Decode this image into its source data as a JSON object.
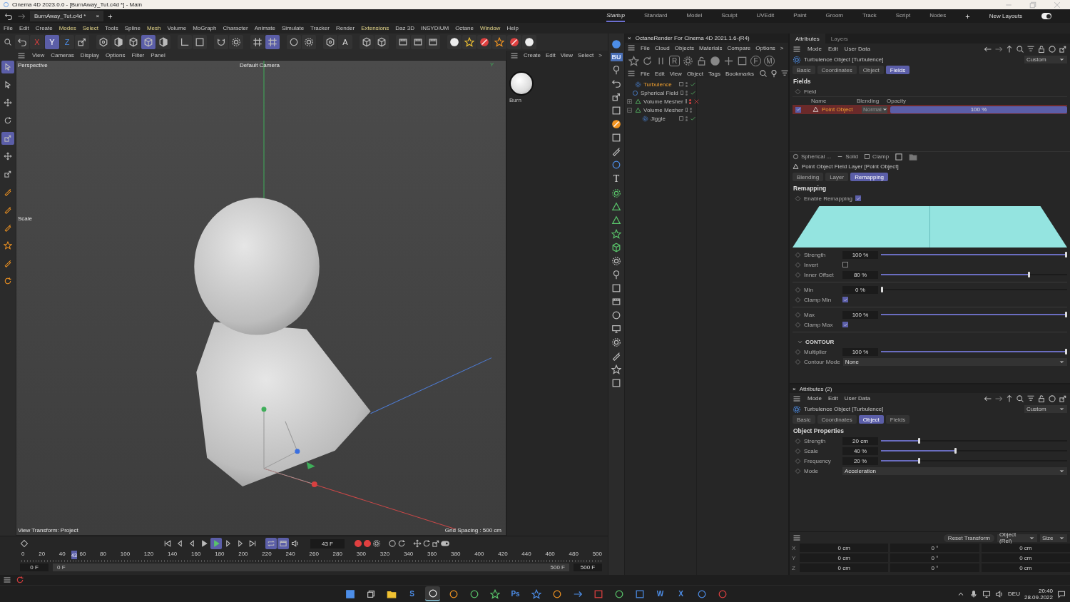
{
  "window": {
    "title": "Cinema 4D 2023.0.0 - [BurnAway_Tut.c4d *] - Main"
  },
  "document_tabs": [
    {
      "label": "BurnAway_Tut.c4d *",
      "close": "×",
      "selected": true
    }
  ],
  "new_tab": "+",
  "layouts": [
    {
      "label": "Startup",
      "selected": true
    },
    {
      "label": "Standard",
      "selected": false
    },
    {
      "label": "Model",
      "selected": false
    },
    {
      "label": "Sculpt",
      "selected": false
    },
    {
      "label": "UVEdit",
      "selected": false
    },
    {
      "label": "Paint",
      "selected": false
    },
    {
      "label": "Groom",
      "selected": false
    },
    {
      "label": "Track",
      "selected": false
    },
    {
      "label": "Script",
      "selected": false
    },
    {
      "label": "Nodes",
      "selected": false
    }
  ],
  "add_layout": "+",
  "new_layouts": {
    "label": "New Layouts",
    "on": true
  },
  "menu_bar": [
    {
      "label": "File",
      "highlighted": false
    },
    {
      "label": "Edit",
      "highlighted": false
    },
    {
      "label": "Create",
      "highlighted": false
    },
    {
      "label": "Modes",
      "highlighted": true
    },
    {
      "label": "Select",
      "highlighted": true
    },
    {
      "label": "Tools",
      "highlighted": false
    },
    {
      "label": "Spline",
      "highlighted": false
    },
    {
      "label": "Mesh",
      "highlighted": true
    },
    {
      "label": "Volume",
      "highlighted": false
    },
    {
      "label": "MoGraph",
      "highlighted": false
    },
    {
      "label": "Character",
      "highlighted": false
    },
    {
      "label": "Animate",
      "highlighted": false
    },
    {
      "label": "Simulate",
      "highlighted": false
    },
    {
      "label": "Tracker",
      "highlighted": false
    },
    {
      "label": "Render",
      "highlighted": false
    },
    {
      "label": "Extensions",
      "highlighted": true
    },
    {
      "label": "Daz 3D",
      "highlighted": false
    },
    {
      "label": "INSYDIUM",
      "highlighted": false
    },
    {
      "label": "Octane",
      "highlighted": false
    },
    {
      "label": "Window",
      "highlighted": true
    },
    {
      "label": "Help",
      "highlighted": false
    }
  ],
  "toolbar": [
    {
      "selected": false
    },
    {
      "label": "X",
      "selected": false
    },
    {
      "label": "Y",
      "selected": true
    },
    {
      "label": "Z",
      "selected": false
    },
    {
      "selected": false
    },
    {
      "selected": false
    },
    {
      "selected": false
    },
    {
      "selected": false
    },
    {
      "selected": true
    },
    {
      "selected": false
    },
    {
      "selected": false
    },
    {
      "selected": false
    },
    {
      "selected": false
    },
    {
      "selected": false
    },
    {
      "selected": false
    },
    {
      "selected": true
    },
    {
      "selected": false
    },
    {
      "selected": false
    },
    {
      "selected": false
    },
    {
      "label": "A",
      "selected": false
    },
    {
      "selected": false
    },
    {
      "selected": false
    },
    {
      "selected": false
    },
    {
      "selected": false
    },
    {
      "selected": false
    },
    {
      "selected": false
    },
    {
      "selected": false
    },
    {
      "selected": false
    },
    {
      "selected": false
    },
    {
      "selected": false
    },
    {
      "selected": false
    }
  ],
  "tool_strip": [
    {
      "selected": true
    },
    {
      "selected": false
    },
    {
      "selected": false
    },
    {
      "selected": false
    },
    {
      "selected": true
    },
    {
      "selected": false
    },
    {
      "selected": false
    },
    {
      "selected": false
    },
    {
      "selected": false
    },
    {
      "selected": false
    },
    {
      "selected": false
    },
    {
      "selected": false
    },
    {
      "selected": false
    }
  ],
  "viewport": {
    "menu": [
      "View",
      "Cameras",
      "Display",
      "Options",
      "Filter",
      "Panel"
    ],
    "camera_view": "Perspective",
    "camera": "Default Camera",
    "tool_label": "Scale",
    "axis_label": "Y",
    "view_transform": "View Transform: Project",
    "grid_spacing": "Grid Spacing : 500 cm"
  },
  "material_manager": {
    "menu": [
      "Create",
      "Edit",
      "View",
      "Select",
      ">"
    ],
    "materials": [
      {
        "name": "Burn"
      }
    ]
  },
  "side_strip": {
    "badge": "BU",
    "text_tool": "T"
  },
  "octane": {
    "close": "×",
    "title": "OctaneRender For Cinema 4D 2021.1.6-(R4)",
    "menu": [
      "File",
      "Cloud",
      "Objects",
      "Materials",
      "Compare",
      "Options",
      ">"
    ],
    "render_button": "R",
    "f_button": "F",
    "m_button": "M"
  },
  "object_manager": {
    "menu": [
      "File",
      "Edit",
      "View",
      "Object",
      "Tags",
      "Bookmarks"
    ],
    "objects": [
      {
        "name": "Turbulence",
        "kind": "deformer",
        "selected": true,
        "enabled": true
      },
      {
        "name": "Spherical Field",
        "kind": "field",
        "selected": false,
        "enabled": true
      },
      {
        "name": "Volume Mesher",
        "kind": "mesher",
        "selected": false,
        "enabled": false,
        "expanded": false
      },
      {
        "name": "Volume Mesher",
        "kind": "mesher",
        "selected": false,
        "expanded": true,
        "children": [
          {
            "name": "Jiggle",
            "kind": "deformer",
            "selected": false,
            "enabled": true
          }
        ]
      }
    ]
  },
  "attributes": {
    "tabs": [
      {
        "label": "Attributes",
        "selected": true
      },
      {
        "label": "Layers",
        "selected": false
      }
    ],
    "menu": [
      "Mode",
      "Edit",
      "User Data"
    ],
    "object_title": "Turbulence Object [Turbulence]",
    "preset": "Custom",
    "object_tabs": [
      {
        "label": "Basic",
        "selected": false
      },
      {
        "label": "Coordinates",
        "selected": false
      },
      {
        "label": "Object",
        "selected": false
      },
      {
        "label": "Fields",
        "selected": true
      }
    ],
    "section": "Fields",
    "field_label": "Field",
    "columns": [
      "Name",
      "Blending",
      "Opacity"
    ],
    "field_rows": [
      {
        "checked": true,
        "name": "Point Object",
        "selected": true,
        "blending": "Normal",
        "opacity": "100 %",
        "level": 1
      }
    ],
    "layer_toolbar": [
      "Spherical ...",
      "Solid",
      "Clamp"
    ],
    "layer_title": "Point Object Field Layer [Point Object]",
    "layer_tabs": [
      {
        "label": "Blending",
        "selected": false
      },
      {
        "label": "Layer",
        "selected": false
      },
      {
        "label": "Remapping",
        "selected": true
      }
    ],
    "remap_section": "Remapping",
    "enable_remapping": {
      "label": "Enable Remapping",
      "checked": true
    },
    "params": [
      {
        "kind": "slider",
        "label": "Strength",
        "value": "100 %",
        "level": 1
      },
      {
        "kind": "checkbox",
        "label": "Invert",
        "checked": false
      },
      {
        "kind": "slider",
        "label": "Inner Offset",
        "value": "80 %",
        "level": 0.8
      },
      {
        "kind": "slider",
        "label": "Min",
        "value": "0 %",
        "level": 0
      },
      {
        "kind": "checkbox",
        "label": "Clamp Min",
        "checked": true
      },
      {
        "kind": "slider",
        "label": "Max",
        "value": "100 %",
        "level": 1
      },
      {
        "kind": "checkbox",
        "label": "Clamp Max",
        "checked": true
      }
    ],
    "contour": {
      "title": "CONTOUR",
      "expanded": true,
      "params": [
        {
          "kind": "slider",
          "label": "Multiplier",
          "value": "100 %",
          "level": 1
        },
        {
          "kind": "dropdown",
          "label": "Contour Mode",
          "value": "None"
        }
      ]
    }
  },
  "attributes_2": {
    "close": "×",
    "title": "Attributes (2)",
    "menu": [
      "Mode",
      "Edit",
      "User Data"
    ],
    "object_title": "Turbulence Object [Turbulence]",
    "preset": "Custom",
    "object_tabs": [
      {
        "label": "Basic",
        "selected": false
      },
      {
        "label": "Coordinates",
        "selected": false
      },
      {
        "label": "Object",
        "selected": true
      },
      {
        "label": "Fields",
        "selected": false
      }
    ],
    "section": "Object Properties",
    "params": [
      {
        "kind": "slider",
        "label": "Strength",
        "value": "20 cm",
        "level": 0.2
      },
      {
        "kind": "slider",
        "label": "Scale",
        "value": "40 %",
        "level": 0.4
      },
      {
        "kind": "slider",
        "label": "Frequency",
        "value": "20 %",
        "level": 0.2
      },
      {
        "kind": "dropdown",
        "label": "Mode",
        "value": "Acceleration"
      }
    ]
  },
  "coordinates": {
    "reset_button": "Reset Transform",
    "mode": "Object (Rel)",
    "size_mode": "Size",
    "rows": [
      {
        "axis": "X",
        "values": [
          "0 cm",
          "0 °",
          "0 cm"
        ]
      },
      {
        "axis": "Y",
        "values": [
          "0 cm",
          "0 °",
          "0 cm"
        ]
      },
      {
        "axis": "Z",
        "values": [
          "0 cm",
          "0 °",
          "0 cm"
        ]
      }
    ]
  },
  "timeline": {
    "transport": [
      {
        "selected": false
      },
      {
        "selected": false
      },
      {
        "selected": false
      },
      {
        "selected": false
      },
      {
        "selected": true
      },
      {
        "selected": false
      },
      {
        "selected": false
      },
      {
        "selected": false
      },
      {
        "selected": true
      },
      {
        "selected": true
      },
      {
        "selected": false
      }
    ],
    "frame": "43 F",
    "ruler": [
      "0",
      "20",
      "40",
      "60",
      "80",
      "100",
      "120",
      "140",
      "160",
      "180",
      "200",
      "220",
      "240",
      "260",
      "280",
      "300",
      "320",
      "340",
      "360",
      "380",
      "400",
      "420",
      "440",
      "460",
      "480",
      "500"
    ],
    "playhead": {
      "label": "43",
      "level": 0.086
    },
    "start_field": "0 F",
    "range_start": "0 F",
    "range_end": "500 F",
    "end_field": "500 F"
  },
  "taskbar": [
    {
      "selected": false
    },
    {
      "selected": false
    },
    {
      "selected": false
    },
    {
      "label": "S",
      "selected": false
    },
    {
      "selected": true
    },
    {
      "selected": false
    },
    {
      "selected": false
    },
    {
      "selected": false
    },
    {
      "label": "Ps",
      "selected": false
    },
    {
      "selected": false
    },
    {
      "selected": false
    },
    {
      "selected": false
    },
    {
      "selected": false
    },
    {
      "selected": false
    },
    {
      "selected": false
    },
    {
      "label": "W",
      "selected": false
    },
    {
      "label": "X",
      "selected": false
    },
    {
      "selected": false
    },
    {
      "selected": false
    }
  ],
  "tray": {
    "language": "DEU",
    "time": "20:40",
    "date": "28.09.2022"
  }
}
